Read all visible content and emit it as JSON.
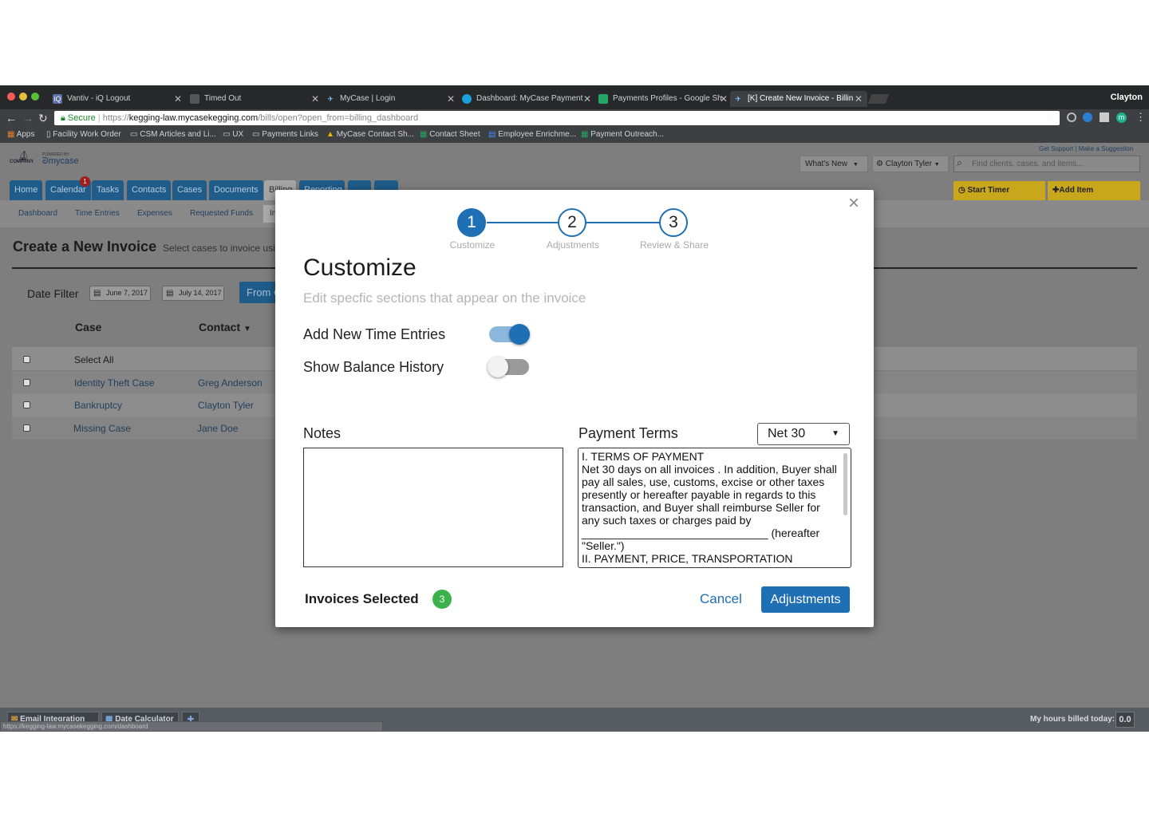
{
  "browser": {
    "profile_name": "Clayton",
    "tabs": [
      {
        "title": "Vantiv - iQ Logout",
        "icon": "iq-icon"
      },
      {
        "title": "Timed Out",
        "icon": "page-icon"
      },
      {
        "title": "MyCase | Login",
        "icon": "mycase-icon"
      },
      {
        "title": "Dashboard: MyCase Payment",
        "icon": "salesforce-icon"
      },
      {
        "title": "Payments Profiles - Google Sh",
        "icon": "sheets-icon"
      },
      {
        "title": "[K] Create New Invoice - Billin",
        "icon": "mycase-icon"
      }
    ],
    "secure_label": "Secure",
    "url_prefix": "https://",
    "url_host": "kegging-law.mycasekegging.com",
    "url_path": "/bills/open?open_from=billing_dashboard",
    "bookmarks": [
      "Apps",
      "Facility Work Order",
      "CSM Articles and Li...",
      "UX",
      "Payments Links",
      "MyCase Contact Sh...",
      "Contact Sheet",
      "Employee Enrichme...",
      "Payment Outreach..."
    ]
  },
  "app": {
    "logo_company": "COMPANY",
    "logo_powered": "POWERED BY",
    "logo_brand": "mycase",
    "top_links": {
      "support": "Get Support",
      "separator": "|",
      "suggestion": "Make a Suggestion"
    },
    "whats_new": "What's New",
    "user_menu": "Clayton Tyler",
    "search_placeholder": "Find clients, cases, and items...",
    "nav": [
      "Home",
      "Calendar",
      "Tasks",
      "Contacts",
      "Cases",
      "Documents",
      "Billing",
      "Reporting"
    ],
    "calendar_badge": "1",
    "start_timer": "Start Timer",
    "add_item": "Add Item",
    "subnav": [
      "Dashboard",
      "Time Entries",
      "Expenses",
      "Requested Funds",
      "In"
    ],
    "page_title": "Create a New Invoice",
    "page_subtitle": "Select cases to invoice usi",
    "date_filter_label": "Date Filter",
    "date_from": "June 7, 2017",
    "date_to": "July 14, 2017",
    "from_button": "From C",
    "table": {
      "headers": [
        "Case",
        "Contact"
      ],
      "select_all": "Select All",
      "rows": [
        {
          "case": "Identity Theft Case",
          "contact": "Greg Anderson"
        },
        {
          "case": "Bankruptcy",
          "contact": "Clayton Tyler"
        },
        {
          "case": "Missing Case",
          "contact": "Jane Doe"
        }
      ]
    },
    "footer": {
      "email_integration": "Email Integration",
      "date_calculator": "Date Calculator",
      "hours_label": "My hours billed today:",
      "hours_value": "0.0",
      "status_url": "https://kegging-law.mycasekegging.com/dashboard"
    }
  },
  "modal": {
    "steps": [
      {
        "number": "1",
        "label": "Customize",
        "active": true
      },
      {
        "number": "2",
        "label": "Adjustments",
        "active": false
      },
      {
        "number": "3",
        "label": "Review & Share",
        "active": false
      }
    ],
    "title": "Customize",
    "subtitle": "Edit specfic sections that appear on the invoice",
    "toggles": [
      {
        "label": "Add New Time Entries",
        "on": true
      },
      {
        "label": "Show Balance History",
        "on": false
      }
    ],
    "notes_label": "Notes",
    "notes_value": "",
    "payment_terms_label": "Payment Terms",
    "payment_terms_selected": "Net 30",
    "payment_terms_text": "I. TERMS OF PAYMENT\nNet 30 days on all invoices . In addition, Buyer shall pay all sales, use, customs, excise or other taxes presently or hereafter payable in regards to this transaction, and Buyer shall reimburse Seller for any such taxes or charges paid by ______________________________ (hereafter \"Seller.\")\nII. PAYMENT, PRICE, TRANSPORTATION",
    "invoices_selected_label": "Invoices Selected",
    "invoices_selected_count": "3",
    "cancel_label": "Cancel",
    "next_label": "Adjustments",
    "close_symbol": "×"
  },
  "colors": {
    "accent": "#1f6fb5",
    "nav_blue": "#1f5c8a",
    "yellow": "#c9a71c",
    "badge_green": "#3cb24a",
    "toggle_on_track": "#8cb7dc",
    "toggle_off_track": "#9a9a9a"
  }
}
